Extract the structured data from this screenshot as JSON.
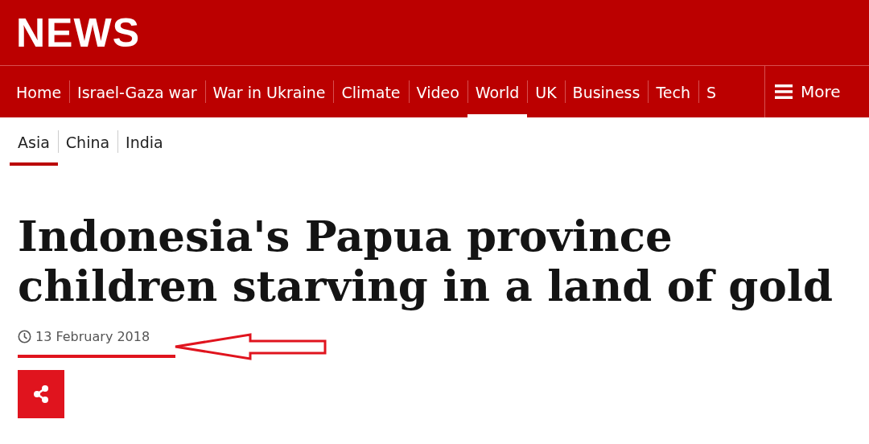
{
  "brand": "NEWS",
  "nav": [
    {
      "label": "Home",
      "selected": false
    },
    {
      "label": "Israel-Gaza war",
      "selected": false
    },
    {
      "label": "War in Ukraine",
      "selected": false
    },
    {
      "label": "Climate",
      "selected": false
    },
    {
      "label": "Video",
      "selected": false
    },
    {
      "label": "World",
      "selected": true
    },
    {
      "label": "UK",
      "selected": false
    },
    {
      "label": "Business",
      "selected": false
    },
    {
      "label": "Tech",
      "selected": false
    },
    {
      "label": "S",
      "selected": false
    }
  ],
  "more": "More",
  "subnav": [
    {
      "label": "Asia",
      "selected": true
    },
    {
      "label": "China",
      "selected": false
    },
    {
      "label": "India",
      "selected": false
    }
  ],
  "headline": "Indonesia's Papua province children starving in a land of gold",
  "date": "13 February 2018"
}
